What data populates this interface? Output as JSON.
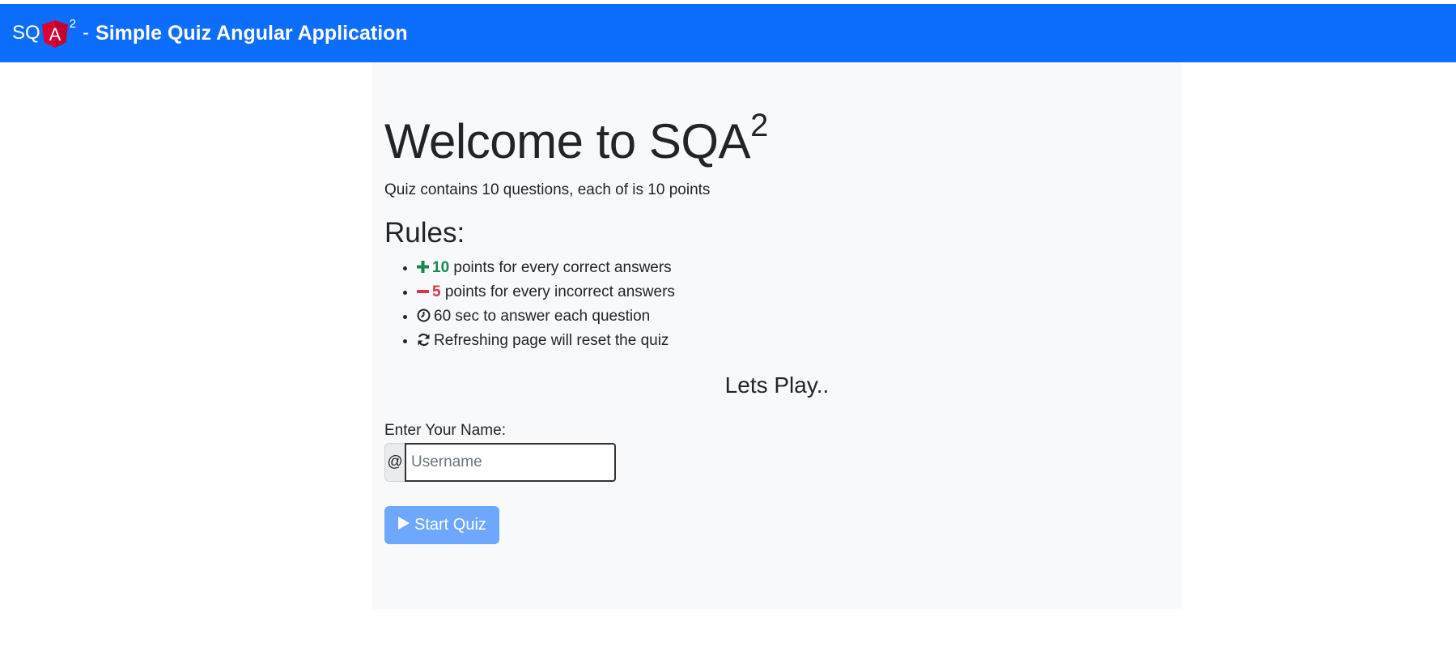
{
  "navbar": {
    "brand_prefix": "SQ",
    "brand_logo_letter": "A",
    "brand_superscript": "2",
    "brand_separator": "-",
    "brand_title": "Simple Quiz Angular Application",
    "background_color": "#0d6efd"
  },
  "main": {
    "heading_text": "Welcome to SQA",
    "heading_superscript": "2",
    "intro": "Quiz contains 10 questions, each of is 10 points",
    "rules_heading": "Rules:",
    "rules": [
      {
        "icon": "plus-icon",
        "highlight": "10",
        "highlight_color": "#198754",
        "text": " points for every correct answers"
      },
      {
        "icon": "minus-icon",
        "highlight": "5",
        "highlight_color": "#dc3545",
        "text": " points for every incorrect answers"
      },
      {
        "icon": "clock-icon",
        "highlight": "",
        "text": "60 sec to answer each question"
      },
      {
        "icon": "refresh-icon",
        "highlight": "",
        "text": "Refreshing page will reset the quiz"
      }
    ],
    "lets_play": "Lets Play..",
    "name_label": "Enter Your Name:",
    "input_addon": "@",
    "username_placeholder": "Username",
    "username_value": "",
    "start_button_label": "Start Quiz",
    "start_button_icon": "play-icon",
    "start_button_color": "#6ea8fe"
  }
}
